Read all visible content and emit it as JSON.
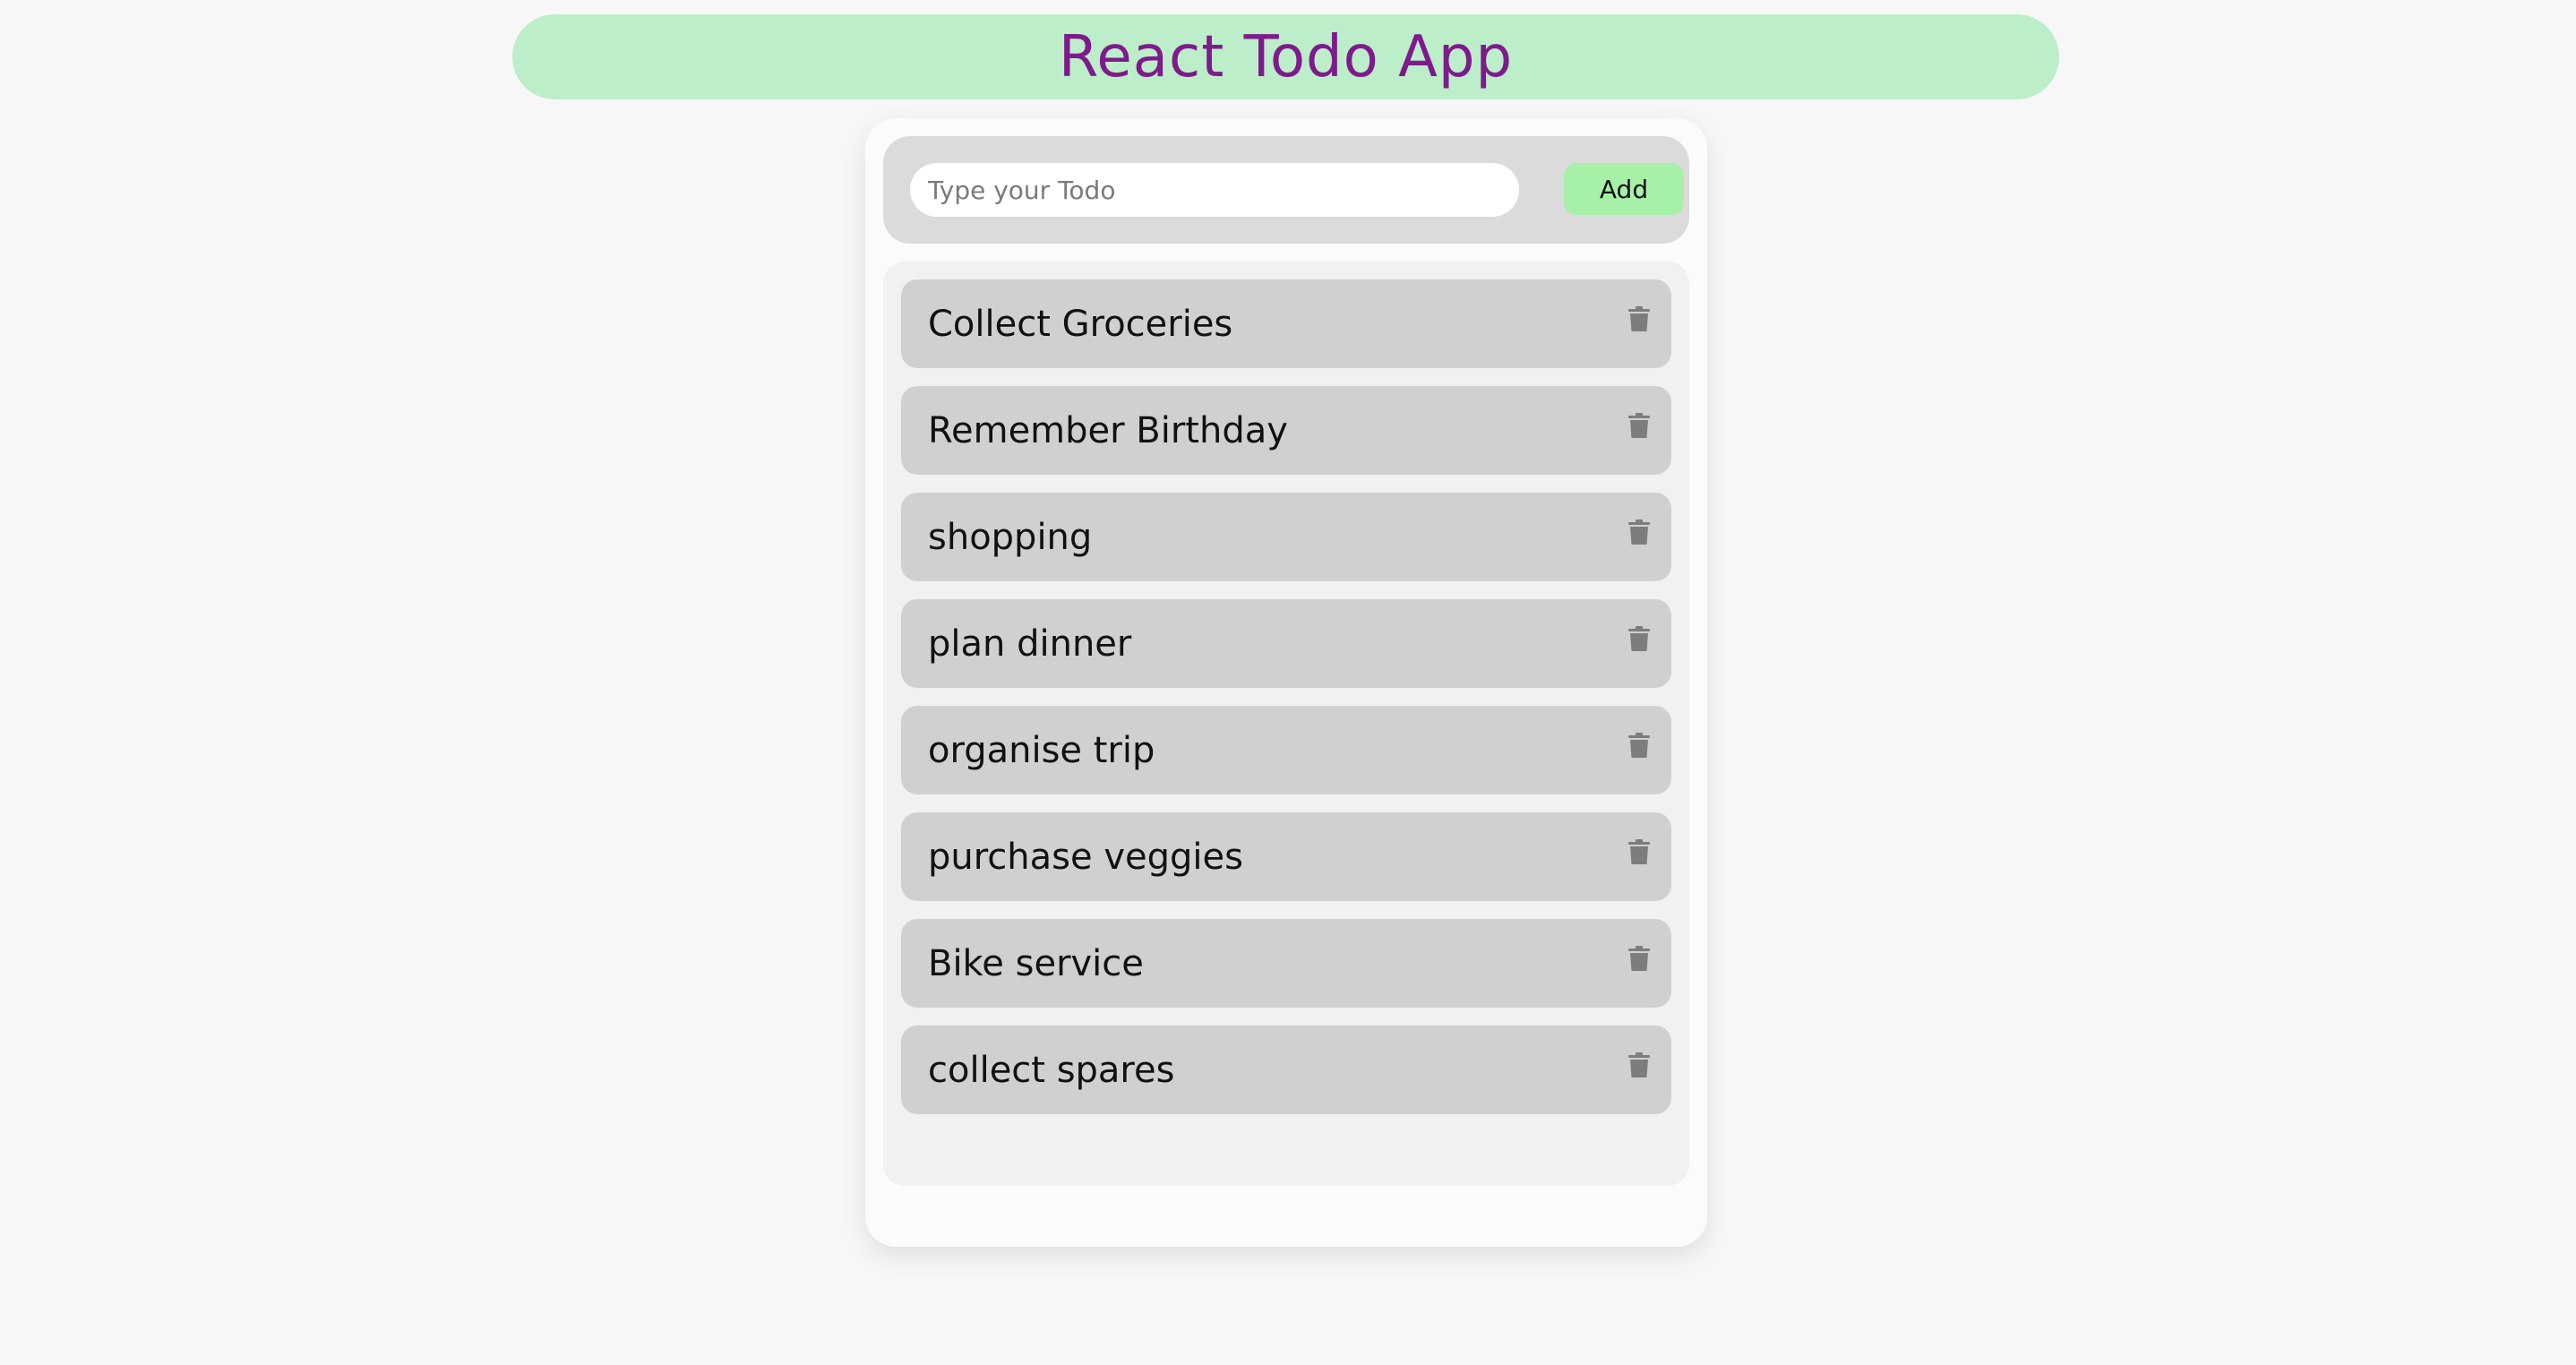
{
  "header": {
    "title": "React Todo App"
  },
  "form": {
    "placeholder": "Type your Todo",
    "value": "",
    "add_label": "Add"
  },
  "todos": [
    {
      "text": "Collect Groceries",
      "icon": "trash-icon"
    },
    {
      "text": "Remember Birthday",
      "icon": "trash-icon"
    },
    {
      "text": "shopping",
      "icon": "trash-icon"
    },
    {
      "text": "plan dinner",
      "icon": "trash-icon"
    },
    {
      "text": "organise trip",
      "icon": "trash-icon"
    },
    {
      "text": "purchase veggies",
      "icon": "trash-icon"
    },
    {
      "text": "Bike service",
      "icon": "trash-icon"
    },
    {
      "text": "collect spares",
      "icon": "trash-icon"
    }
  ],
  "colors": {
    "header_bg": "#bbeec9",
    "title_color": "#7f1a8c",
    "add_button_bg": "#a6f0a8",
    "item_bg": "#d1d0d1",
    "trash_icon": "#7d7d7d"
  }
}
